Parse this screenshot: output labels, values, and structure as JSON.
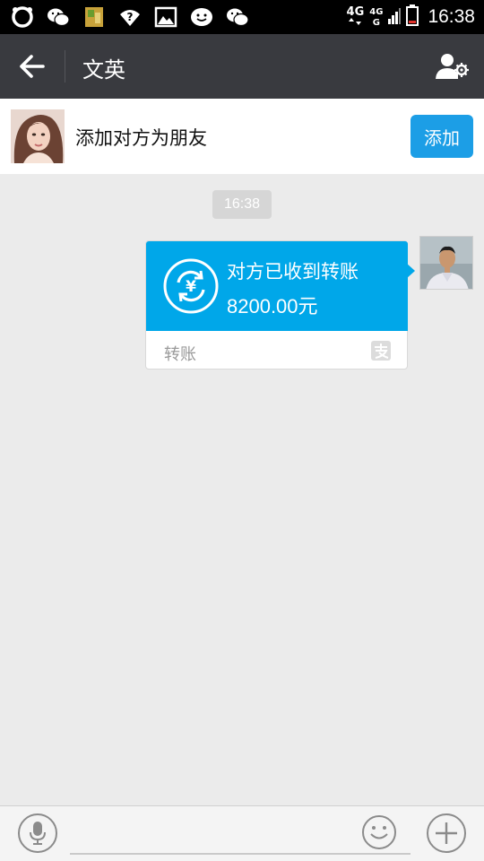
{
  "status_bar": {
    "time": "16:38",
    "network_primary": "4G",
    "network_secondary": "4G",
    "network_sub": "G",
    "icons": [
      "circle-app-icon",
      "wechat-icon",
      "sd-card-icon",
      "wifi-question-icon",
      "gallery-icon",
      "emoji-notify-icon",
      "wechat-icon",
      "signal-icon",
      "battery-icon"
    ]
  },
  "header": {
    "title": "文英",
    "back_icon": "arrow-left-icon",
    "profile_icon": "user-settings-icon"
  },
  "add_friend": {
    "text": "添加对方为朋友",
    "button_label": "添加"
  },
  "chat": {
    "time_chip": "16:38",
    "transfer": {
      "status": "对方已收到转账",
      "amount": "8200.00元",
      "footer_label": "转账",
      "icon": "yuan-refresh-icon",
      "brand_icon": "alipay-icon"
    }
  },
  "input_bar": {
    "voice_icon": "mic-icon",
    "emoji_icon": "smile-icon",
    "plus_icon": "plus-icon"
  },
  "colors": {
    "title_bar": "#393a3f",
    "accent_blue": "#00a7e9",
    "add_button": "#1c9ee6",
    "chat_bg": "#ebebeb"
  }
}
